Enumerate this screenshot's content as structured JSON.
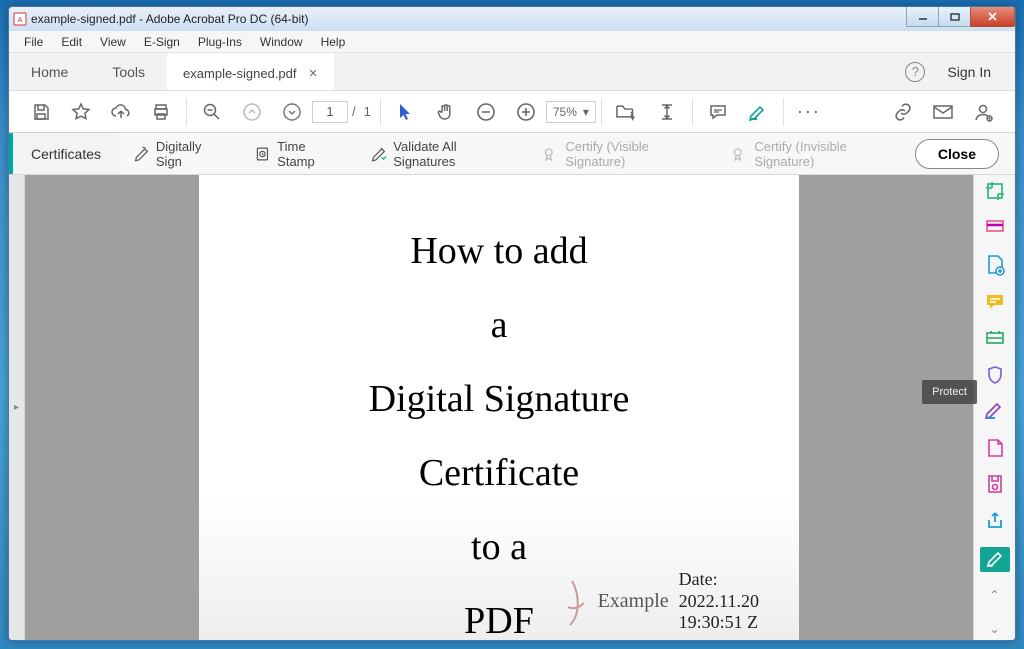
{
  "window": {
    "title": "example-signed.pdf - Adobe Acrobat Pro DC (64-bit)"
  },
  "menu": {
    "file": "File",
    "edit": "Edit",
    "view": "View",
    "esign": "E-Sign",
    "plugins": "Plug-Ins",
    "windowm": "Window",
    "help": "Help"
  },
  "tabs": {
    "home": "Home",
    "tools": "Tools",
    "doc": "example-signed.pdf"
  },
  "topright": {
    "signin": "Sign In"
  },
  "pagenav": {
    "current": "1",
    "sep": "/",
    "total": "1"
  },
  "zoom": {
    "pct": "75%"
  },
  "cert": {
    "label": "Certificates",
    "sign": "Digitally Sign",
    "timestamp": "Time Stamp",
    "validate": "Validate All Signatures",
    "cvisible": "Certify (Visible Signature)",
    "cinvisible": "Certify (Invisible Signature)",
    "close": "Close"
  },
  "doc": {
    "l1": "How to add",
    "l2": "a",
    "l3": "Digital Signature",
    "l4": "Certificate",
    "l5": "to a",
    "l6": "PDF",
    "sigtext": "Example",
    "datelbl": "Date:",
    "date1": "2022.11.20",
    "date2": "19:30:51 Z"
  },
  "tooltip": "Protect",
  "ellipsis": "···"
}
